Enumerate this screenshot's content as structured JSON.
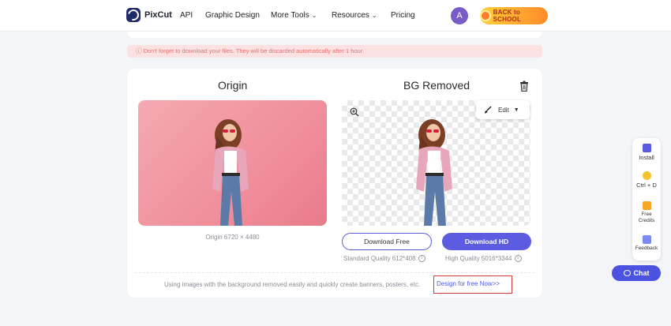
{
  "header": {
    "logo_text": "PixCut",
    "nav": [
      {
        "label": "API",
        "has_caret": false
      },
      {
        "label": "Graphic Design",
        "has_caret": false
      },
      {
        "label": "More Tools",
        "has_caret": true
      },
      {
        "label": "Resources",
        "has_caret": true
      },
      {
        "label": "Pricing",
        "has_caret": false
      }
    ],
    "avatar_letter": "A",
    "promo_text": "BACK to SCHOOL"
  },
  "notice": {
    "text": "Don't forget to download your files. They will be discarded automatically after 1 hour.",
    "icon": "info-circle-icon"
  },
  "result": {
    "origin_title": "Origin",
    "removed_title": "BG Removed",
    "origin_size": "Origin 6720 × 4480",
    "edit_label": "Edit",
    "download_free_label": "Download Free",
    "download_hd_label": "Download HD",
    "standard_quality": "Standard Quality 612*408",
    "high_quality": "High Quality 5016*3344",
    "footer_text": "Using images with the background removed easily and quickly create banners, posters, etc.",
    "footer_link": "Design for free Now>>"
  },
  "sidebar": {
    "items": [
      {
        "label": "Install",
        "icon": "install-icon"
      },
      {
        "label": "Ctrl + D",
        "icon": "star-icon"
      },
      {
        "label": "Free Credits",
        "icon": "gift-icon"
      },
      {
        "label": "Feedback",
        "icon": "feedback-icon"
      }
    ]
  },
  "chat": {
    "label": "Chat"
  },
  "colors": {
    "accent": "#5b5ce0",
    "notice_bg": "#fbe1e1",
    "notice_text": "#e4716f",
    "highlight_border": "#d63a3a"
  }
}
